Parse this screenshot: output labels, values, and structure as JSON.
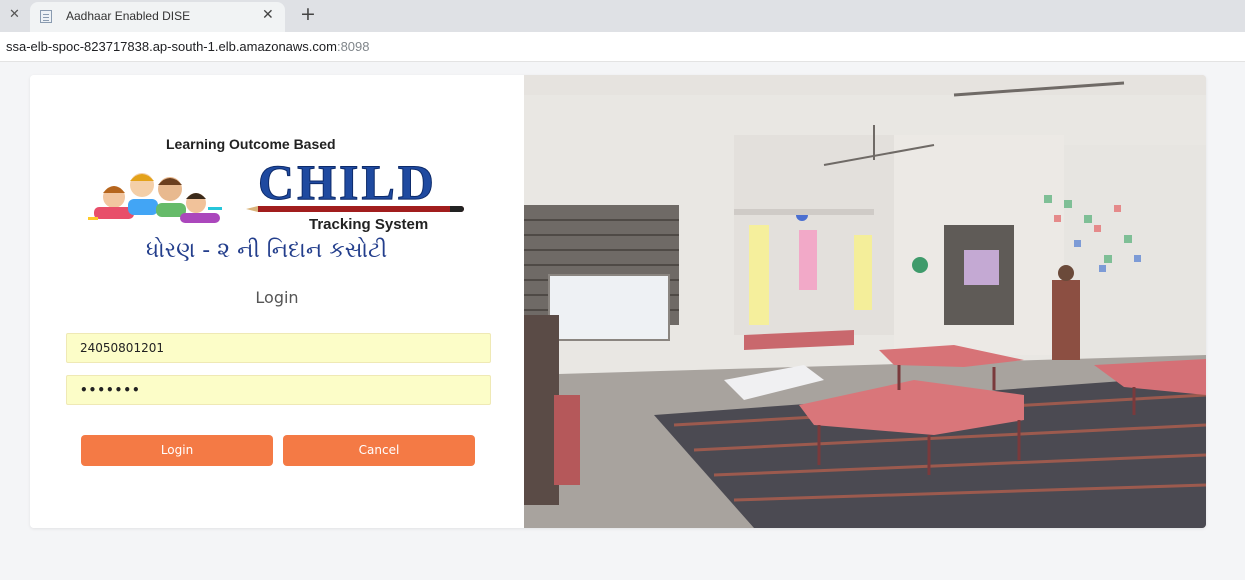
{
  "browser": {
    "tab_title": "Aadhaar Enabled DISE",
    "url_host": "ssa-elb-spoc-823717838.ap-south-1.elb.amazonaws.com",
    "url_port": ":8098"
  },
  "logo": {
    "top_line": "Learning Outcome Based",
    "main_word": "CHILD",
    "sub_line": "Tracking System",
    "gujarati_line": "ધોરણ - ૨ ની નિદાન કસોટી"
  },
  "login": {
    "heading": "Login",
    "username_value": "24050801201",
    "password_display": "•••••••",
    "login_button": "Login",
    "cancel_button": "Cancel"
  },
  "colors": {
    "accent": "#f47a45",
    "input_bg": "#fcfdc8",
    "logo_blue": "#1f4aa0"
  }
}
